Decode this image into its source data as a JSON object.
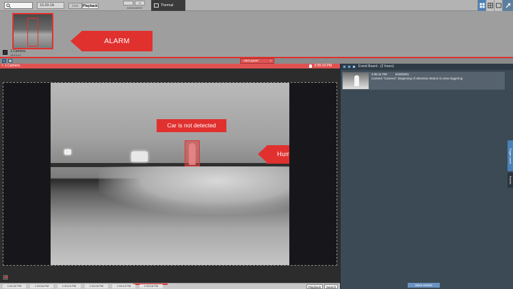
{
  "toolbar": {
    "search_placeholder": "",
    "layout_value": "1S-03-1A",
    "mode_live": "Live",
    "mode_playback": "Playback",
    "assignment_value_1": "",
    "assignment_value_2": "0",
    "assignment_label": "ASSIGNMENT",
    "active_tab": "Thermal Cameras"
  },
  "alarm_strip": {
    "callout": "ALARM TRIGGERED",
    "camera_name": "1.Camera",
    "camera_time": "15:13:12"
  },
  "panel_bar": {
    "alert_tab": "Alert panel",
    "alert_close": "×"
  },
  "camera": {
    "title": "1.Camera",
    "timestamp": "3:35:19 PM",
    "label_car": "Car is not detected",
    "label_human": "Human detected"
  },
  "timeline": {
    "ticks": [
      "1:32:42 PM",
      "1:33:04 PM",
      "1:33:10 PM",
      "1:33:16 PM",
      "1:33:10 PM",
      "1:33:16 PM"
    ],
    "playback": "Playback",
    "search": "Search"
  },
  "event_board": {
    "title": "Event Board - (2 hours)",
    "items": [
      {
        "time": "3:35:11 PM",
        "date": "5/18/2021",
        "desc": "Camera \"Camera\": Beginning of detection Motion in area triggering"
      }
    ],
    "more": "More events",
    "side_trigger": "Trigger panel",
    "side_events": "Events"
  },
  "colors": {
    "alarm_red": "#e0312f",
    "accent_blue": "#4a80b5",
    "board_bg": "#3c4a55"
  }
}
